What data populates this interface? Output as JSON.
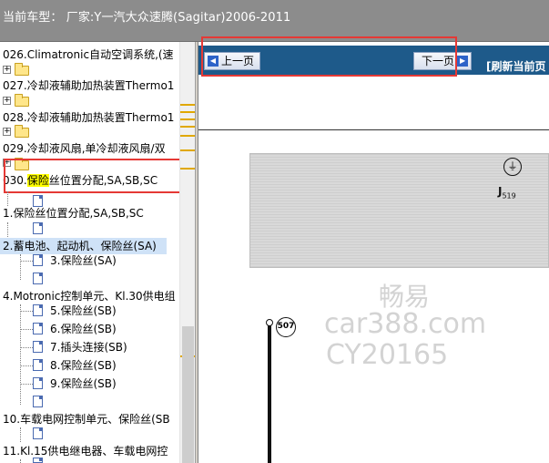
{
  "header": {
    "title": "当前车型：  厂家:Y一汽大众速腾(Sagitar)2006-2011"
  },
  "tree": {
    "items": [
      {
        "label": "026.Climatronic自动空调系统,(速"
      },
      {
        "label": "027.冷却液辅助加热装置Thermo1"
      },
      {
        "label": "028.冷却液辅助加热装置Thermo1"
      },
      {
        "label": "029.冷却液风扇,单冷却液风扇/双"
      },
      {
        "label_prefix": "030.",
        "label_highlight": "保险",
        "label_suffix": "丝位置分配,SA,SB,SC"
      },
      {
        "label": "1.保险丝位置分配,SA,SB,SC"
      },
      {
        "label": "2.蓄电池、起动机、保险丝(SA)"
      },
      {
        "label": "3.保险丝(SA)"
      },
      {
        "label": "4.Motronic控制单元、Kl.30供电组"
      },
      {
        "label": "5.保险丝(SB)"
      },
      {
        "label": "6.保险丝(SB)"
      },
      {
        "label": "7.插头连接(SB)"
      },
      {
        "label": "8.保险丝(SB)"
      },
      {
        "label": "9.保险丝(SB)"
      },
      {
        "label": "10.车载电网控制单元、保险丝(SB"
      },
      {
        "label": "11.Kl.15供电继电器、车载电网控"
      }
    ]
  },
  "nav": {
    "prev_label": "上一页",
    "next_label": "下一页",
    "refresh_label": "[刷新当前页"
  },
  "diagram": {
    "ground_symbol": "⏚",
    "component": "J",
    "component_sub": "519",
    "node_label": "507"
  },
  "watermark": {
    "line1": "畅易",
    "line2": "car388.com",
    "line3": "CY20165"
  },
  "colors": {
    "nav_bg": "#1e5a8a",
    "selected_row": "#cfe2f7",
    "highlight": "#ffff00",
    "red_box": "#e53935"
  }
}
